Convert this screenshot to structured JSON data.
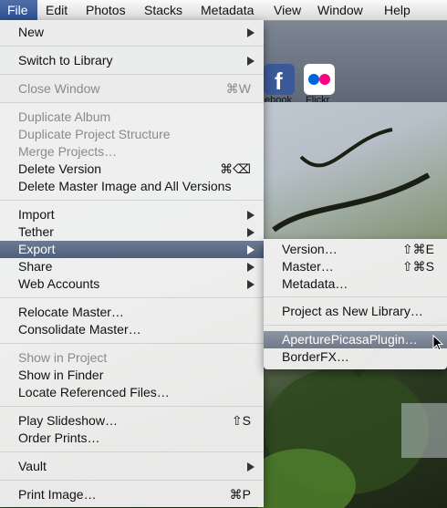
{
  "menubar": {
    "items": [
      {
        "label": "File"
      },
      {
        "label": "Edit"
      },
      {
        "label": "Photos"
      },
      {
        "label": "Stacks"
      },
      {
        "label": "Metadata"
      },
      {
        "label": "View"
      },
      {
        "label": "Window"
      },
      {
        "label": "Help"
      }
    ]
  },
  "toolbar": {
    "facebook_label": "ebook",
    "flickr_label": "Flickr"
  },
  "file_menu": {
    "new": "New",
    "switch_to_library": "Switch to Library",
    "close_window": "Close Window",
    "close_window_shortcut": "⌘W",
    "duplicate_album": "Duplicate Album",
    "duplicate_project_structure": "Duplicate Project Structure",
    "merge_projects": "Merge Projects…",
    "delete_version": "Delete Version",
    "delete_version_shortcut": "⌘⌫",
    "delete_master": "Delete Master Image and All Versions",
    "import": "Import",
    "tether": "Tether",
    "export": "Export",
    "share": "Share",
    "web_accounts": "Web Accounts",
    "relocate_master": "Relocate Master…",
    "consolidate_master": "Consolidate Master…",
    "show_in_project": "Show in Project",
    "show_in_finder": "Show in Finder",
    "locate_referenced_files": "Locate Referenced Files…",
    "play_slideshow": "Play Slideshow…",
    "play_slideshow_shortcut": "⇧S",
    "order_prints": "Order Prints…",
    "vault": "Vault",
    "print_image": "Print Image…",
    "print_image_shortcut": "⌘P"
  },
  "export_menu": {
    "version": "Version…",
    "version_shortcut": "⇧⌘E",
    "master": "Master…",
    "master_shortcut": "⇧⌘S",
    "metadata": "Metadata…",
    "project_as_new_library": "Project as New Library…",
    "aperture_picasa_plugin": "AperturePicasaPlugin…",
    "borderfx": "BorderFX…"
  },
  "colors": {
    "menu_highlight": "#4f5f78",
    "menubar_active": "#2e4f93",
    "facebook": "#3b5998",
    "flickr_blue": "#0063dc",
    "flickr_pink": "#ff0084"
  }
}
